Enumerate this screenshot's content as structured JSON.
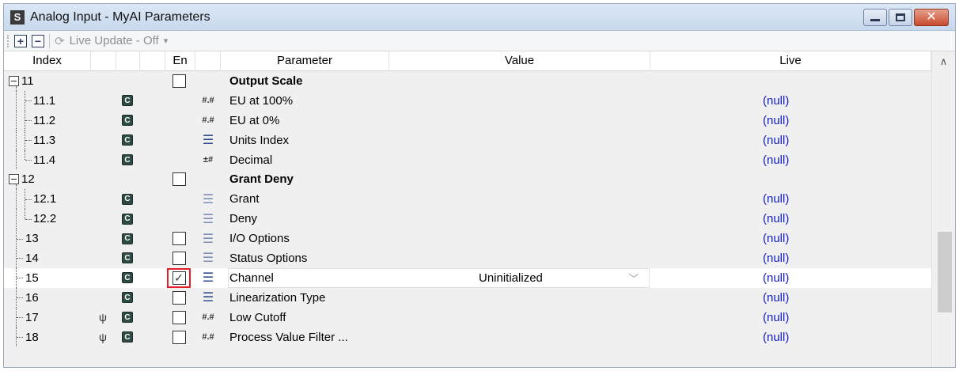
{
  "window": {
    "app_icon_letter": "S",
    "title": "Analog Input - MyAI Parameters",
    "close_glyph": "✕"
  },
  "toolbar": {
    "expand_all": "+",
    "collapse_all": "−",
    "live_update_label": "Live Update - Off",
    "live_update_arrow": "▾",
    "refresh_glyph": "⟳"
  },
  "columns": {
    "index": "Index",
    "en": "En",
    "parameter": "Parameter",
    "value": "Value",
    "live": "Live"
  },
  "rows": [
    {
      "index": "11",
      "parameter": "Output Scale",
      "group": true,
      "enabled": false,
      "show_checkbox": true,
      "has_c": false,
      "type_icon": "",
      "value": "",
      "live": ""
    },
    {
      "index": "11.1",
      "parameter": "EU at 100%",
      "type_icon": "#.#",
      "has_c": true,
      "live": "(null)"
    },
    {
      "index": "11.2",
      "parameter": "EU at 0%",
      "type_icon": "#.#",
      "has_c": true,
      "live": "(null)"
    },
    {
      "index": "11.3",
      "parameter": "Units Index",
      "type_icon": "☰",
      "has_c": true,
      "live": "(null)"
    },
    {
      "index": "11.4",
      "parameter": "Decimal",
      "type_icon": "±#",
      "has_c": true,
      "live": "(null)"
    },
    {
      "index": "12",
      "parameter": "Grant Deny",
      "group": true,
      "enabled": false,
      "show_checkbox": true,
      "has_c": false,
      "live": ""
    },
    {
      "index": "12.1",
      "parameter": "Grant",
      "type_icon": "☰",
      "has_c": true,
      "live": "(null)"
    },
    {
      "index": "12.2",
      "parameter": "Deny",
      "type_icon": "☰",
      "has_c": true,
      "live": "(null)"
    },
    {
      "index": "13",
      "parameter": "I/O Options",
      "type_icon": "☰",
      "has_c": true,
      "show_checkbox": true,
      "enabled": false,
      "live": "(null)"
    },
    {
      "index": "14",
      "parameter": "Status Options",
      "type_icon": "☰",
      "has_c": true,
      "show_checkbox": true,
      "enabled": false,
      "live": "(null)"
    },
    {
      "index": "15",
      "parameter": "Channel",
      "type_icon": "☰",
      "has_c": true,
      "show_checkbox": true,
      "enabled": true,
      "value": "Uninitialized",
      "live": "(null)"
    },
    {
      "index": "16",
      "parameter": "Linearization Type",
      "type_icon": "☰",
      "has_c": true,
      "show_checkbox": true,
      "enabled": false,
      "live": "(null)"
    },
    {
      "index": "17",
      "parameter": "Low Cutoff",
      "type_icon": "#.#",
      "has_c": true,
      "lock": true,
      "show_checkbox": true,
      "enabled": false,
      "live": "(null)"
    },
    {
      "index": "18",
      "parameter": "Process Value Filter ...",
      "type_icon": "#.#",
      "has_c": true,
      "lock": true,
      "show_checkbox": true,
      "enabled": false,
      "live": "(null)"
    }
  ],
  "badge_letter": "C",
  "lock_glyph": "ψ",
  "dropdown_arrow": "﹀",
  "scroll_up_arrow": "∧",
  "colors": {
    "live_text": "#1520c8",
    "highlight_frame": "#e3202a",
    "badge_bg": "#2e4a44"
  }
}
